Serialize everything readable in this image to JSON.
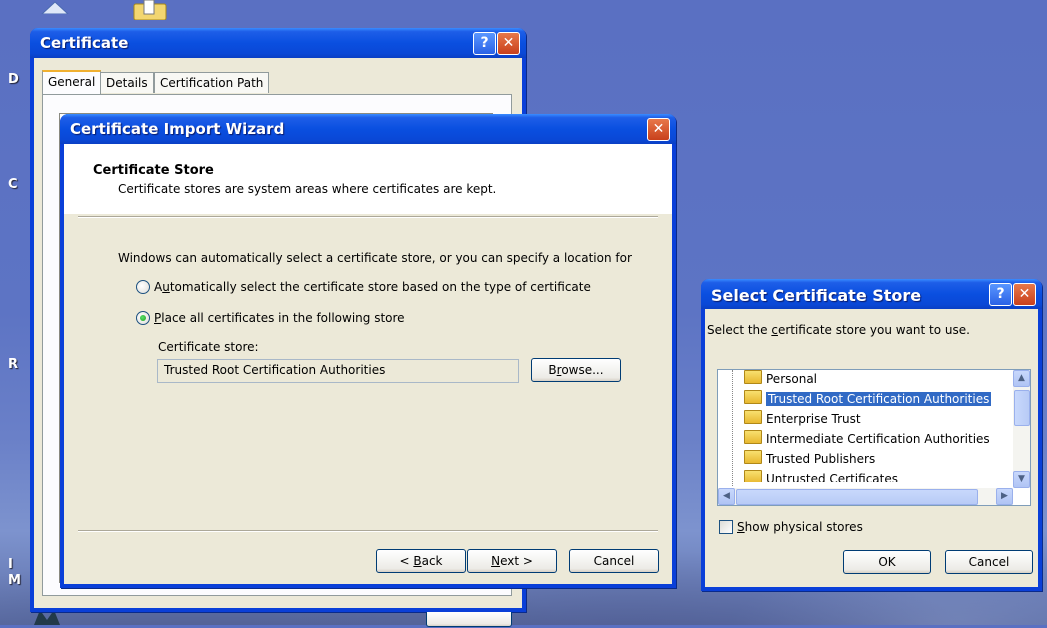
{
  "desktop": {
    "side_letters": [
      "D",
      "C",
      "R",
      "I",
      "M"
    ]
  },
  "certificate_window": {
    "title": "Certificate",
    "tabs": [
      "General",
      "Details",
      "Certification Path"
    ]
  },
  "wizard": {
    "title": "Certificate Import Wizard",
    "header_title": "Certificate Store",
    "header_subtitle": "Certificate stores are system areas where certificates are kept.",
    "intro": "Windows can automatically select a certificate store, or you can specify a location for",
    "radio_auto": {
      "prefix": "A",
      "mnemonic": "u",
      "rest": "tomatically select the certificate store based on the type of certificate",
      "checked": false
    },
    "radio_place": {
      "prefix": "",
      "mnemonic": "P",
      "rest": "lace all certificates in the following store",
      "checked": true
    },
    "store_label": "Certificate store:",
    "store_value": "Trusted Root Certification Authorities",
    "browse": {
      "prefix": "B",
      "mnemonic": "r",
      "rest": "owse..."
    },
    "back": {
      "prefix": "< ",
      "mnemonic": "B",
      "rest": "ack"
    },
    "next": {
      "prefix": "",
      "mnemonic": "N",
      "rest": "ext >"
    },
    "cancel": "Cancel"
  },
  "select_store": {
    "title": "Select Certificate Store",
    "prompt": {
      "prefix": "Select the ",
      "mnemonic": "c",
      "rest": "ertificate store you want to use."
    },
    "stores": [
      {
        "label": "Personal",
        "selected": false
      },
      {
        "label": "Trusted Root Certification Authorities",
        "selected": true
      },
      {
        "label": "Enterprise Trust",
        "selected": false
      },
      {
        "label": "Intermediate Certification Authorities",
        "selected": false
      },
      {
        "label": "Trusted Publishers",
        "selected": false
      },
      {
        "label": "Untrusted Certificates",
        "selected": false
      }
    ],
    "show_physical": {
      "prefix": "",
      "mnemonic": "S",
      "rest": "how physical stores",
      "checked": false
    },
    "ok": "OK",
    "cancel": "Cancel"
  },
  "icons": [
    "recycle-bin-icon",
    "folder-icon",
    "help-icon",
    "close-icon",
    "radio-icon",
    "checkbox-icon",
    "scroll-up-icon",
    "scroll-down-icon",
    "scroll-left-icon",
    "scroll-right-icon"
  ]
}
